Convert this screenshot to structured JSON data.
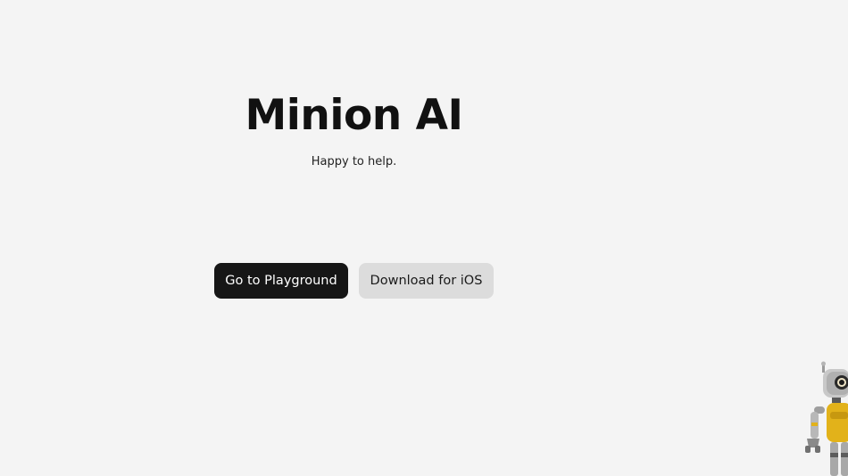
{
  "hero": {
    "title": "Minion AI",
    "subtitle": "Happy to help."
  },
  "actions": {
    "primary_label": "Go to Playground",
    "secondary_label": "Download for iOS"
  },
  "mascot": {
    "icon": "robot-mascot-icon"
  },
  "colors": {
    "background": "#f4f4f4",
    "primary_button": "#161616",
    "secondary_button": "#dcdcdc",
    "mascot_accent": "#e2b21a"
  }
}
